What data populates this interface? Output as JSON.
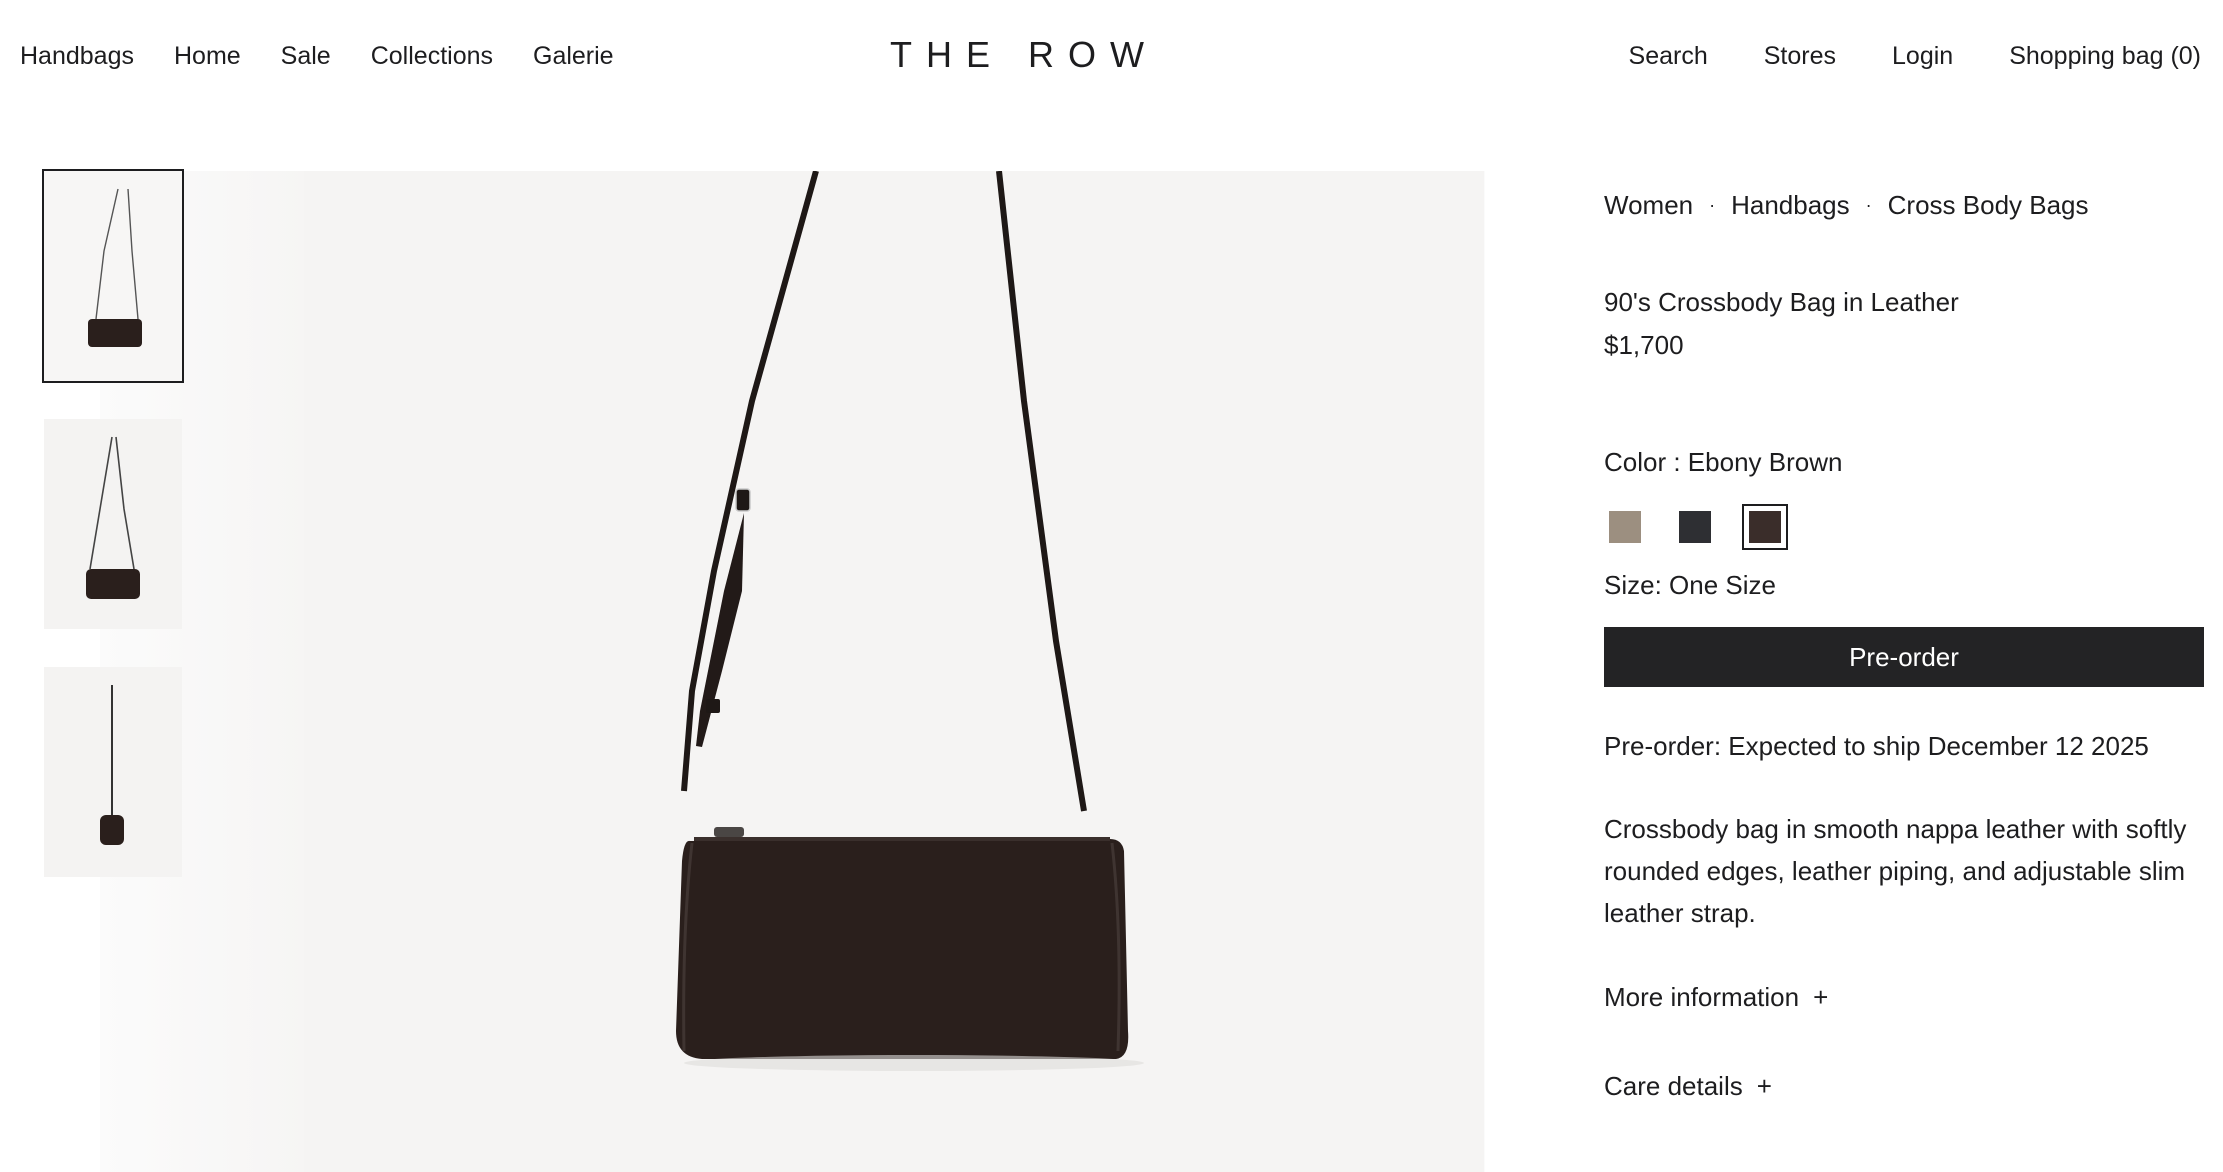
{
  "header": {
    "nav_left": [
      "Handbags",
      "Home",
      "Sale",
      "Collections",
      "Galerie"
    ],
    "logo": "THE ROW",
    "nav_right": {
      "search": "Search",
      "stores": "Stores",
      "login": "Login",
      "bag": "Shopping bag (0)"
    }
  },
  "gallery": {
    "selected_index": 0,
    "thumbnail_count": 3
  },
  "product": {
    "breadcrumb": [
      "Women",
      "Handbags",
      "Cross Body Bags"
    ],
    "breadcrumb_separator": "·",
    "title": "90's Crossbody Bag in Leather",
    "price": "$1,700",
    "color_label": "Color : Ebony Brown",
    "swatches": [
      {
        "color": "#9c8f80"
      },
      {
        "color": "#2e2f33"
      },
      {
        "color": "#3a2d2a",
        "selected": true
      }
    ],
    "size_label": "Size: One Size",
    "cta": "Pre-order",
    "ship_note": "Pre-order: Expected to ship December 12 2025",
    "description": "Crossbody bag in smooth nappa leather with softly rounded edges, leather piping, and adjustable slim leather strap.",
    "accordions": [
      {
        "label": "More information",
        "icon": "+"
      },
      {
        "label": "Care details",
        "icon": "+"
      }
    ]
  }
}
